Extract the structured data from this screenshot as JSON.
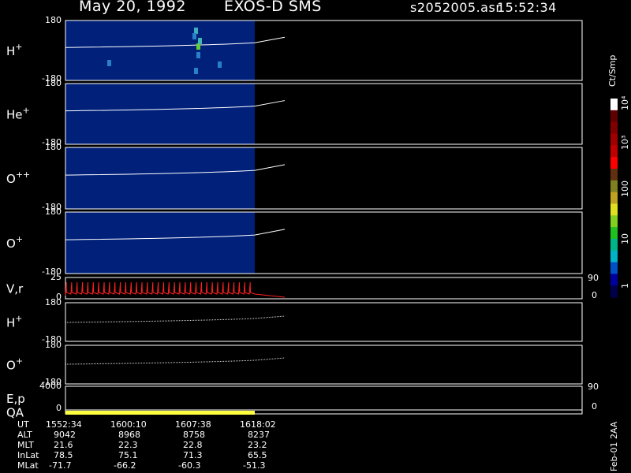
{
  "header": {
    "date": "May 20, 1992",
    "instrument": "EXOS-D SMS",
    "file": "s2052005.asr",
    "time": "15:52:34"
  },
  "colorbar": {
    "title": "Ct/Smp",
    "tick_labels": [
      "1",
      "10",
      "100",
      "10³",
      "10⁴"
    ]
  },
  "version_label": "Feb-01 2AA",
  "ephemeris": {
    "row_labels": [
      "UT",
      "ALT",
      "MLT",
      "InLat",
      "MLat"
    ],
    "columns": [
      [
        "1552:34",
        "9042",
        "21.6",
        "78.5",
        "-71.7"
      ],
      [
        "1600:10",
        "8968",
        "22.3",
        "75.1",
        "-66.2"
      ],
      [
        "1607:38",
        "8758",
        "22.8",
        "71.3",
        "-60.3"
      ],
      [
        "1618:02",
        "8237",
        "23.2",
        "65.5",
        "-51.3"
      ]
    ]
  },
  "chart_data": [
    {
      "type": "heatmap",
      "panel": "H+",
      "label": "H",
      "superscript": "+",
      "ylim": [
        -180,
        180
      ],
      "tick_labels": [
        "180",
        "-180"
      ],
      "colorscale": "log counts/sample (1 to 10^4)",
      "data_extent_fraction": 0.6,
      "background_value": "~1 (dark blue)",
      "features": "burst of higher counts (up to ~100) near 1604 UT",
      "overlay_line": "white pitch-angle trace, slight upward drift"
    },
    {
      "type": "heatmap",
      "panel": "He+",
      "label": "He",
      "superscript": "+",
      "ylim": [
        -180,
        180
      ],
      "tick_labels": [
        "180",
        "-180"
      ],
      "background_value": "~1 (dark blue)",
      "overlay_line": "white pitch-angle trace"
    },
    {
      "type": "heatmap",
      "panel": "O++",
      "label": "O",
      "superscript": "++",
      "ylim": [
        -180,
        180
      ],
      "tick_labels": [
        "180",
        "-180"
      ],
      "background_value": "~1 (dark blue)",
      "overlay_line": "white pitch-angle trace"
    },
    {
      "type": "heatmap",
      "panel": "O+",
      "label": "O",
      "superscript": "+",
      "ylim": [
        -180,
        180
      ],
      "tick_labels": [
        "180",
        "-180"
      ],
      "background_value": "~1 (dark blue)",
      "overlay_line": "white pitch-angle trace"
    },
    {
      "type": "line",
      "panel": "V,r",
      "label": "V,r",
      "superscript": "",
      "ylim": [
        0,
        25
      ],
      "tick_labels": [
        "25",
        "0"
      ],
      "right_tick_labels": [
        "90",
        "0"
      ],
      "series_color": "#ff2020",
      "style": "repeating sawtooth (~35 cycles), then flat near 0"
    },
    {
      "type": "line",
      "panel": "H+ (angle)",
      "label": "H",
      "superscript": "+",
      "ylim": [
        -180,
        180
      ],
      "tick_labels": [
        "180",
        "-180"
      ]
    },
    {
      "type": "line",
      "panel": "O+ (angle)",
      "label": "O",
      "superscript": "+",
      "ylim": [
        -180,
        180
      ],
      "tick_labels": [
        "180",
        "-180"
      ]
    },
    {
      "type": "line",
      "panel": "E,p",
      "label": "E,p",
      "superscript": "",
      "ylim": [
        0,
        4000
      ],
      "tick_labels": [
        "4000",
        "0"
      ],
      "right_tick_labels": [
        "90",
        "0"
      ]
    },
    {
      "type": "bar",
      "panel": "QA",
      "label": "QA",
      "superscript": "",
      "bar_color": "#ffff40",
      "data_extent_fraction": 0.6
    }
  ]
}
